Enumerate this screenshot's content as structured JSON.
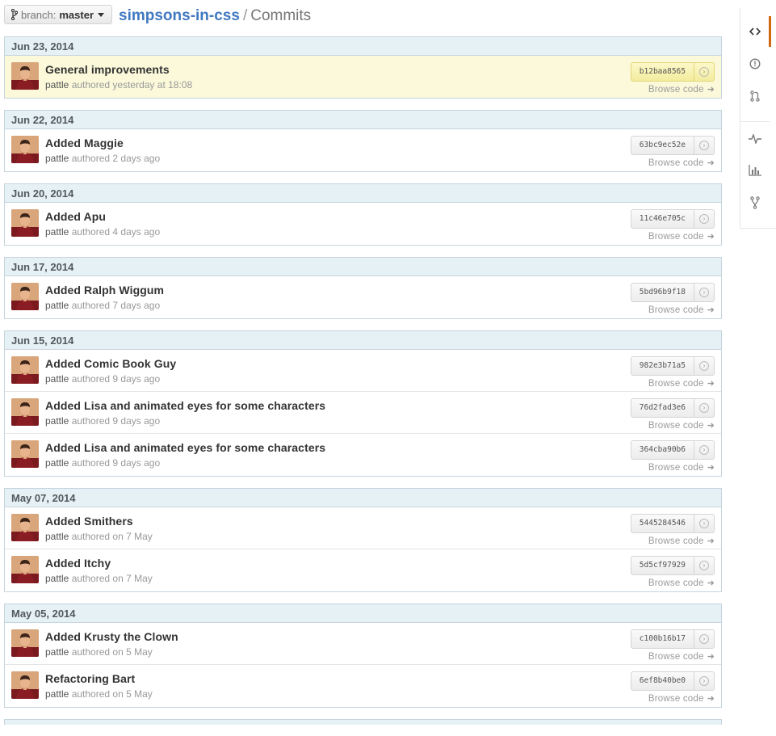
{
  "branch": {
    "prefix": "branch:",
    "name": "master"
  },
  "breadcrumb": {
    "repo": "simpsons-in-css",
    "separator": "/",
    "section": "Commits"
  },
  "commit_groups": [
    {
      "date": "Jun 23, 2014",
      "commits": [
        {
          "title": "General improvements",
          "author": "pattle",
          "meta": "authored yesterday at 18:08",
          "sha": "b12baa8565",
          "browse": "Browse code",
          "highlight": true
        }
      ]
    },
    {
      "date": "Jun 22, 2014",
      "commits": [
        {
          "title": "Added Maggie",
          "author": "pattle",
          "meta": "authored 2 days ago",
          "sha": "63bc9ec52e",
          "browse": "Browse code"
        }
      ]
    },
    {
      "date": "Jun 20, 2014",
      "commits": [
        {
          "title": "Added Apu",
          "author": "pattle",
          "meta": "authored 4 days ago",
          "sha": "11c46e705c",
          "browse": "Browse code"
        }
      ]
    },
    {
      "date": "Jun 17, 2014",
      "commits": [
        {
          "title": "Added Ralph Wiggum",
          "author": "pattle",
          "meta": "authored 7 days ago",
          "sha": "5bd96b9f18",
          "browse": "Browse code"
        }
      ]
    },
    {
      "date": "Jun 15, 2014",
      "commits": [
        {
          "title": "Added Comic Book Guy",
          "author": "pattle",
          "meta": "authored 9 days ago",
          "sha": "982e3b71a5",
          "browse": "Browse code"
        },
        {
          "title": "Added Lisa and animated eyes for some characters",
          "author": "pattle",
          "meta": "authored 9 days ago",
          "sha": "76d2fad3e6",
          "browse": "Browse code"
        },
        {
          "title": "Added Lisa and animated eyes for some characters",
          "author": "pattle",
          "meta": "authored 9 days ago",
          "sha": "364cba90b6",
          "browse": "Browse code"
        }
      ]
    },
    {
      "date": "May 07, 2014",
      "commits": [
        {
          "title": "Added Smithers",
          "author": "pattle",
          "meta": "authored on 7 May",
          "sha": "5445284546",
          "browse": "Browse code"
        },
        {
          "title": "Added Itchy",
          "author": "pattle",
          "meta": "authored on 7 May",
          "sha": "5d5cf97929",
          "browse": "Browse code"
        }
      ]
    },
    {
      "date": "May 05, 2014",
      "commits": [
        {
          "title": "Added Krusty the Clown",
          "author": "pattle",
          "meta": "authored on 5 May",
          "sha": "c100b16b17",
          "browse": "Browse code"
        },
        {
          "title": "Refactoring Bart",
          "author": "pattle",
          "meta": "authored on 5 May",
          "sha": "6ef8b40be0",
          "browse": "Browse code"
        }
      ]
    }
  ],
  "sidebar": {
    "items": [
      {
        "icon": "code-icon",
        "selected": true
      },
      {
        "icon": "issues-icon"
      },
      {
        "icon": "pull-request-icon"
      },
      {
        "icon": "pulse-icon"
      },
      {
        "icon": "graphs-icon"
      },
      {
        "icon": "network-icon"
      }
    ]
  },
  "colors": {
    "link": "#4078c0",
    "group_header_bg": "#e6f1f6",
    "highlight_bg": "#fbf9da",
    "accent_orange": "#d26911"
  }
}
